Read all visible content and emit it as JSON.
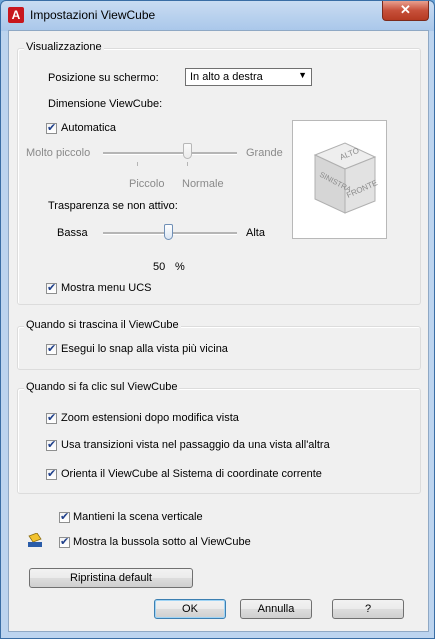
{
  "window": {
    "title": "Impostazioni ViewCube",
    "close_glyph": "✕",
    "app_icon": "A"
  },
  "visualizzazione": {
    "group_title": "Visualizzazione",
    "position_label": "Posizione su schermo:",
    "position_value": "In alto a destra",
    "size_label": "Dimensione ViewCube:",
    "automatic_label": "Automatica",
    "automatic_checked": true,
    "size_slider": {
      "min_label": "Molto piccolo",
      "max_label": "Grande",
      "tick_label_1": "Piccolo",
      "tick_label_2": "Normale",
      "value_label": "Normale",
      "enabled": false
    },
    "transparency_label": "Trasparenza se non attivo:",
    "transparency_slider": {
      "min_label": "Bassa",
      "max_label": "Alta",
      "value": 50
    },
    "transparency_value": "50",
    "transparency_unit": "%",
    "ucs_menu_label": "Mostra menu UCS",
    "ucs_menu_checked": true,
    "cube_faces": {
      "top": "ALTO",
      "left": "SINISTRA",
      "front": "FRONTE"
    }
  },
  "drag": {
    "group_title": "Quando si trascina il ViewCube",
    "snap_label": "Esegui lo snap alla vista più vicina",
    "snap_checked": true
  },
  "click": {
    "group_title": "Quando si fa clic sul ViewCube",
    "zoom_label": "Zoom estensioni dopo modifica vista",
    "transitions_label": "Usa transizioni vista nel passaggio da una vista all'altra",
    "orient_label": "Orienta il ViewCube al Sistema di coordinate corrente",
    "all_checked": true
  },
  "keep_upright_label": "Mantieni la scena verticale",
  "show_compass_label": "Mostra la bussola sotto al ViewCube",
  "buttons": {
    "restore": "Ripristina default",
    "ok": "OK",
    "cancel": "Annulla",
    "help": "?"
  },
  "colors": {
    "title_bar": "#a9c7ea",
    "close_button": "#c7503a",
    "dialog_bg": "#f0f0f0",
    "check_mark": "#1e3f8a"
  }
}
